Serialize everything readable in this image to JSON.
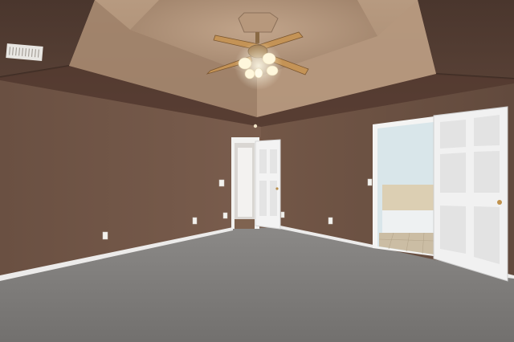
{
  "scene": {
    "subject": "empty-bedroom-interior",
    "colors": {
      "wall": "#6e5446",
      "wall_shadow": "#5a4338",
      "ceiling_outer": "#4e3a30",
      "tray_slope": "#a78a70",
      "tray_inner": "#9b7e66",
      "carpet": "#7f7d7b",
      "baseboard": "#ecebea",
      "door": "#f1f1f1",
      "door_panel": "#e1e1e1",
      "bath_wall": "#d9e6ea",
      "bath_tile": "#cbbda4",
      "fan_blade": "#b88a55",
      "fan_light": "#fff7dc"
    }
  }
}
